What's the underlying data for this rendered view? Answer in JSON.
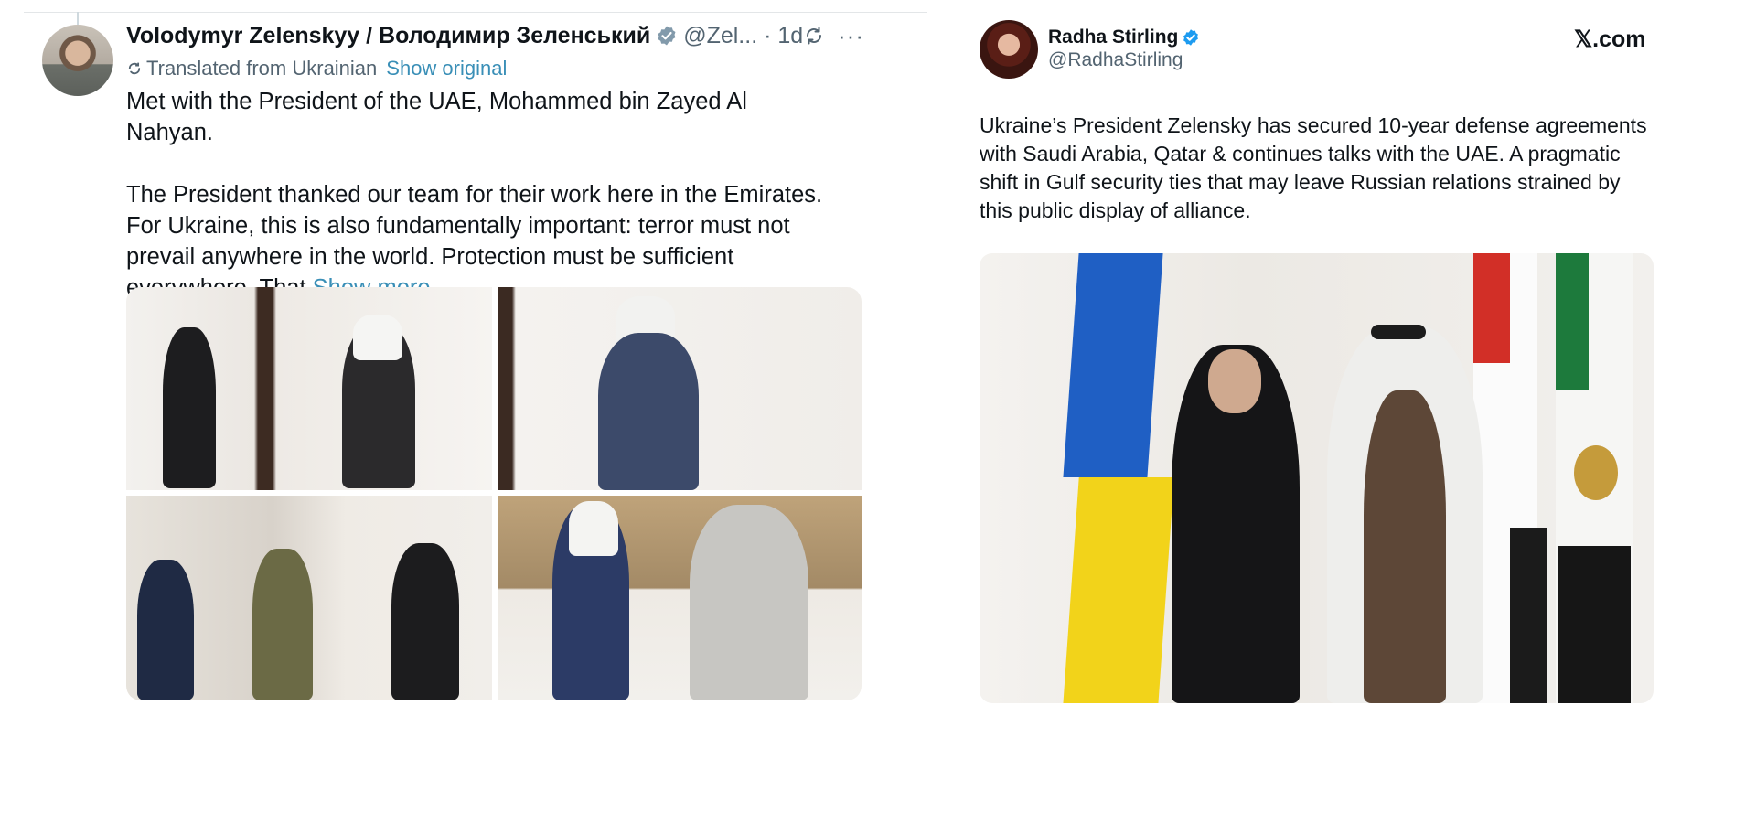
{
  "left_tweet": {
    "display_name": "Volodymyr Zelenskyy / Володимир Зеленський",
    "handle_time": "@Zel... · 1d",
    "more_label": "···",
    "translated_label": "Translated from Ukrainian",
    "show_original_label": "Show original",
    "text_line1": "Met with the President of the UAE, Mohammed bin Zayed Al Nahyan.",
    "text_para2": "The President thanked our team for their work here in the Emirates. For Ukraine, this is also fundamentally important: terror must not prevail anywhere in the world. Protection must be sufficient everywhere. That",
    "show_more_label": "Show more",
    "icons": {
      "verified": "verified-badge-icon",
      "repost": "repost-icon",
      "more": "more-icon",
      "translate": "translate-icon"
    },
    "colors": {
      "link": "#3a8fb7",
      "verified": "#829aab",
      "secondary_text": "#536471"
    }
  },
  "right_tweet": {
    "display_name": "Radha Stirling",
    "handle": "@RadhaStirling",
    "source_label": "𝕏.com",
    "text": "Ukraine’s President Zelensky has secured 10-year defense agreements with Saudi Arabia, Qatar & continues talks with the UAE.  A pragmatic shift in Gulf security ties that may leave Russian relations strained by this public display of alliance.",
    "icons": {
      "verified": "verified-badge-icon"
    },
    "colors": {
      "verified": "#1d9bf0"
    }
  }
}
